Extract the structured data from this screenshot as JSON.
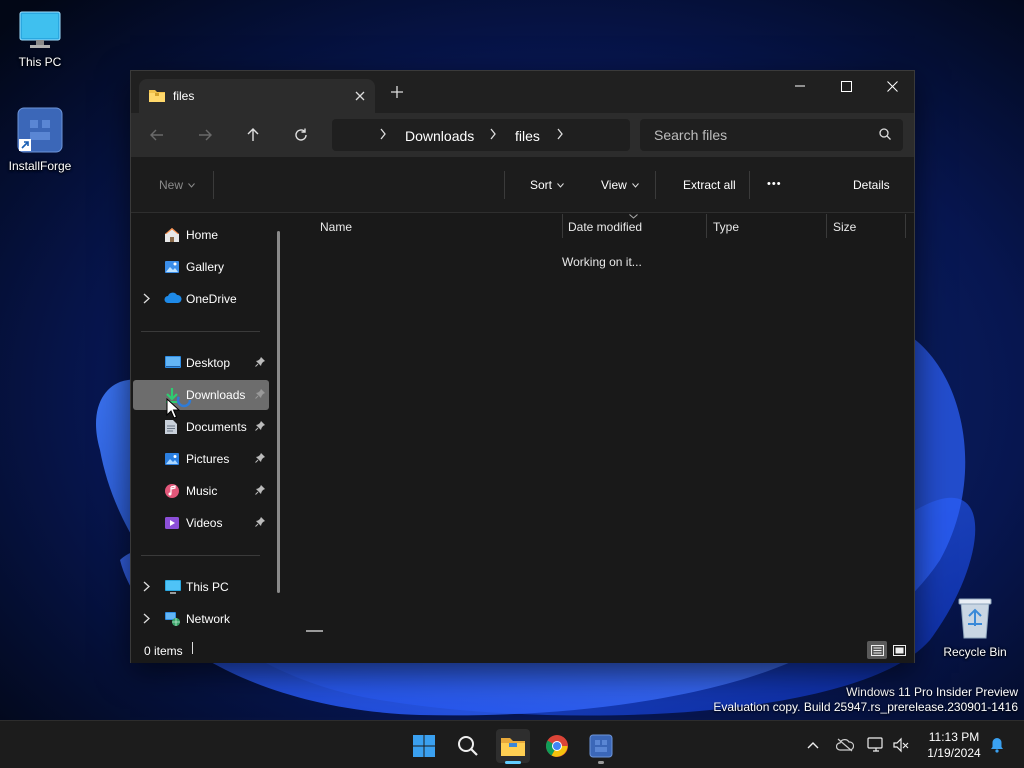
{
  "desktop": {
    "icons": [
      {
        "label": "This PC",
        "icon": "monitor-icon"
      },
      {
        "label": "InstallForge",
        "icon": "installforge-icon"
      },
      {
        "label": "Recycle Bin",
        "icon": "recycle-bin-icon"
      }
    ],
    "watermark": {
      "line1": "Windows 11 Pro Insider Preview",
      "line2": "Evaluation copy. Build 25947.rs_prerelease.230901-1416"
    }
  },
  "window": {
    "tab": {
      "title": "files",
      "icon": "folder-icon"
    },
    "navigation": {
      "back": "back-arrow-icon",
      "forward": "forward-arrow-icon",
      "up": "up-arrow-icon",
      "refresh": "refresh-icon"
    },
    "breadcrumb": [
      "Downloads",
      "files"
    ],
    "search": {
      "placeholder": "Search files"
    },
    "toolbar": {
      "new_label": "New",
      "sort_label": "Sort",
      "view_label": "View",
      "extract_label": "Extract all",
      "more_label": "•••",
      "details_label": "Details"
    },
    "sidebar": {
      "items": [
        {
          "label": "Home",
          "icon": "home-icon"
        },
        {
          "label": "Gallery",
          "icon": "gallery-icon"
        },
        {
          "label": "OneDrive",
          "icon": "cloud-icon"
        },
        {
          "label": "Desktop",
          "icon": "desktop-icon"
        },
        {
          "label": "Downloads",
          "icon": "download-icon"
        },
        {
          "label": "Documents",
          "icon": "document-icon"
        },
        {
          "label": "Pictures",
          "icon": "picture-icon"
        },
        {
          "label": "Music",
          "icon": "music-icon"
        },
        {
          "label": "Videos",
          "icon": "video-icon"
        },
        {
          "label": "This PC",
          "icon": "computer-icon"
        },
        {
          "label": "Network",
          "icon": "network-icon"
        }
      ],
      "selected": "Downloads"
    },
    "columns": [
      "Name",
      "Date modified",
      "Type",
      "Size"
    ],
    "content_status": "Working on it...",
    "status_bar": {
      "items_count": "0 items"
    }
  },
  "taskbar": {
    "apps": [
      "start-icon",
      "search-icon",
      "file-explorer-icon",
      "chrome-icon",
      "installforge-icon"
    ],
    "clock": {
      "time": "11:13 PM",
      "date": "1/19/2024"
    }
  },
  "colors": {
    "accent": "#60cdff",
    "window_bg": "#191919",
    "selected_bg": "#6d6d6d"
  }
}
